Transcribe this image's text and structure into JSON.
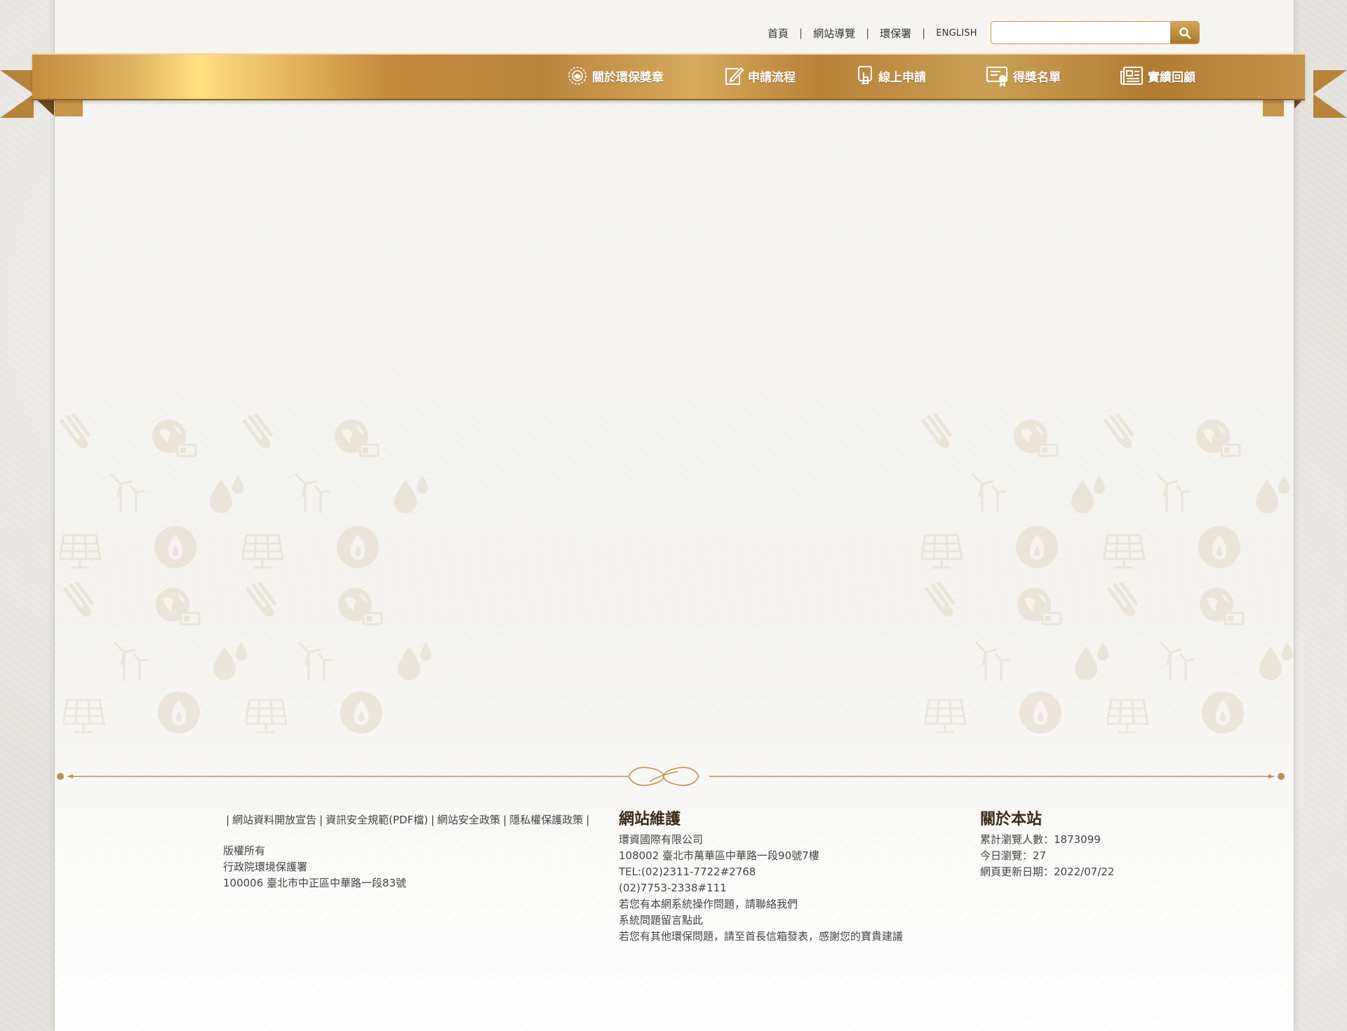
{
  "top_nav": {
    "home": "首頁",
    "sitemap": "網站導覽",
    "epa": "環保署",
    "english": "ENGLISH",
    "separator": "|"
  },
  "search": {
    "placeholder": "",
    "value": "",
    "button_icon": "search-icon"
  },
  "main_nav": [
    {
      "label": "關於環保獎章",
      "icon": "medal-icon"
    },
    {
      "label": "申請流程",
      "icon": "edit-icon"
    },
    {
      "label": "線上申請",
      "icon": "touch-icon"
    },
    {
      "label": "得獎名單",
      "icon": "certificate-icon"
    },
    {
      "label": "實績回顧",
      "icon": "newspaper-icon"
    }
  ],
  "footer": {
    "policy_links": [
      "網站資料開放宣告",
      "資訊安全規範(PDF檔)",
      "網站安全政策",
      "隱私權保護政策"
    ],
    "bar": "|",
    "copyright": [
      "版權所有",
      "行政院環境保護署",
      "100006 臺北市中正區中華路一段83號"
    ],
    "maintenance": {
      "title": "網站維護",
      "lines": [
        "環資國際有限公司",
        "108002 臺北市萬華區中華路一段90號7樓",
        "TEL:(02)2311-7722#2768",
        "(02)7753-2338#111"
      ],
      "contact_text": "若您有本網系統操作問題，請聯絡我們",
      "message_link": "系統問題留言點此",
      "mailbox_text": "若您有其他環保問題，請至首長信箱發表，感謝您的寶貴建議"
    },
    "about": {
      "title": "關於本站",
      "total_views": "累計瀏覽人數：1873099",
      "today_views": "今日瀏覽：27",
      "updated": "網頁更新日期：2022/07/22"
    }
  },
  "colors": {
    "gold": "#c39048",
    "gold_light": "#ffe07f",
    "text": "#444444",
    "heading": "#3a2c1c"
  }
}
